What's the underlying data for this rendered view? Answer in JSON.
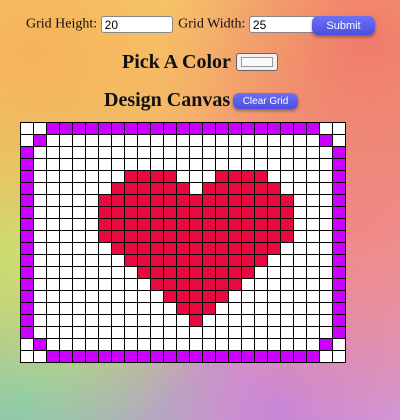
{
  "form": {
    "height_label": "Grid Height:",
    "height_value": "20",
    "width_label": "Grid Width:",
    "width_value": "25",
    "submit_label": "Submit"
  },
  "color_picker": {
    "title": "Pick A Color",
    "value": "#f0f0f0"
  },
  "canvas": {
    "title": "Design Canvas",
    "clear_label": "Clear Grid",
    "rows": 20,
    "cols": 25,
    "colors": {
      "P": "#cc00ff",
      "R": "#e8093f",
      ".": "#ffffff"
    },
    "pattern": [
      "..PPPPPPPPPPPPPPPPPPPPP..",
      ".P.....................P.",
      "P.......................P",
      "P.......................P",
      "P.......RRRR...RRRR.....P",
      "P......RRRRRR.RRRRRR....P",
      "P.....RRRRRRRRRRRRRRR...P",
      "P.....RRRRRRRRRRRRRRR...P",
      "P.....RRRRRRRRRRRRRRR...P",
      "P.....RRRRRRRRRRRRRRR...P",
      "P......RRRRRRRRRRRRR....P",
      "P.......RRRRRRRRRRR.....P",
      "P........RRRRRRRRR......P",
      "P.........RRRRRRR.......P",
      "P..........RRRRR........P",
      "P...........RRR.........P",
      "P............R..........P",
      "P.......................P",
      ".P.....................P.",
      "..PPPPPPPPPPPPPPPPPPPPP.."
    ]
  }
}
